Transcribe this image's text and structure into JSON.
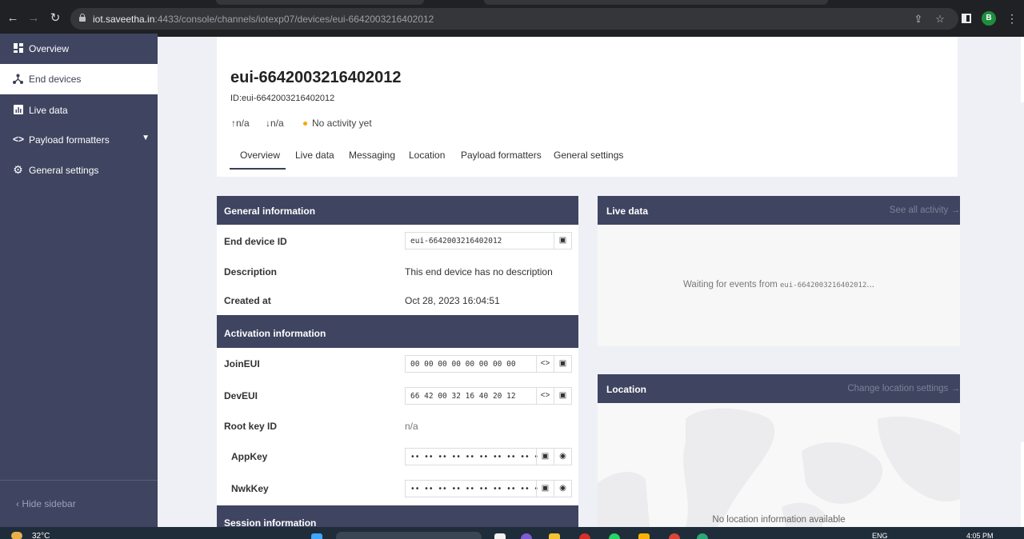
{
  "browser": {
    "url_host": "iot.saveetha.in",
    "url_path": ":4433/console/channels/iotexp07/devices/eui-6642003216402012",
    "profile_initial": "B"
  },
  "sidebar": {
    "items": [
      {
        "label": "Overview"
      },
      {
        "label": "End devices"
      },
      {
        "label": "Live data"
      },
      {
        "label": "Payload formatters"
      },
      {
        "label": "General settings"
      }
    ],
    "hide_label": "Hide sidebar"
  },
  "device": {
    "title": "eui-6642003216402012",
    "id_line": "ID:eui-6642003216402012",
    "uplink": "n/a",
    "downlink": "n/a",
    "activity": "No activity yet"
  },
  "tabs": [
    "Overview",
    "Live data",
    "Messaging",
    "Location",
    "Payload formatters",
    "General settings"
  ],
  "general": {
    "title": "General information",
    "end_device_id_label": "End device ID",
    "end_device_id": "eui-6642003216402012",
    "description_label": "Description",
    "description": "This end device has no description",
    "created_label": "Created at",
    "created": "Oct 28, 2023 16:04:51"
  },
  "activation": {
    "title": "Activation information",
    "join_eui_label": "JoinEUI",
    "join_eui": "00 00 00 00 00 00 00 00",
    "dev_eui_label": "DevEUI",
    "dev_eui": "66 42 00 32 16 40 20 12",
    "root_key_label": "Root key ID",
    "root_key": "n/a",
    "app_key_label": "AppKey",
    "app_key": "•• •• •• •• •• •• •• •• •• •• •• •• •• •• •• ••",
    "nwk_key_label": "NwkKey",
    "nwk_key": "•• •• •• •• •• •• •• •• •• •• •• •• •• •• •• ••"
  },
  "session": {
    "title": "Session information"
  },
  "live": {
    "title": "Live data",
    "link": "See all activity →",
    "waiting": "Waiting for events from ",
    "device": "eui-6642003216402012",
    "ellipsis": "..."
  },
  "location": {
    "title": "Location",
    "link": "Change location settings →",
    "empty": "No location information available"
  },
  "taskbar": {
    "weather": "32°C",
    "lang": "ENG",
    "time": "4:05 PM"
  },
  "colors": {
    "sidebar_bg": "#3f4460",
    "panel_head": "#3f4460",
    "activity_dot": "#f2a900"
  }
}
